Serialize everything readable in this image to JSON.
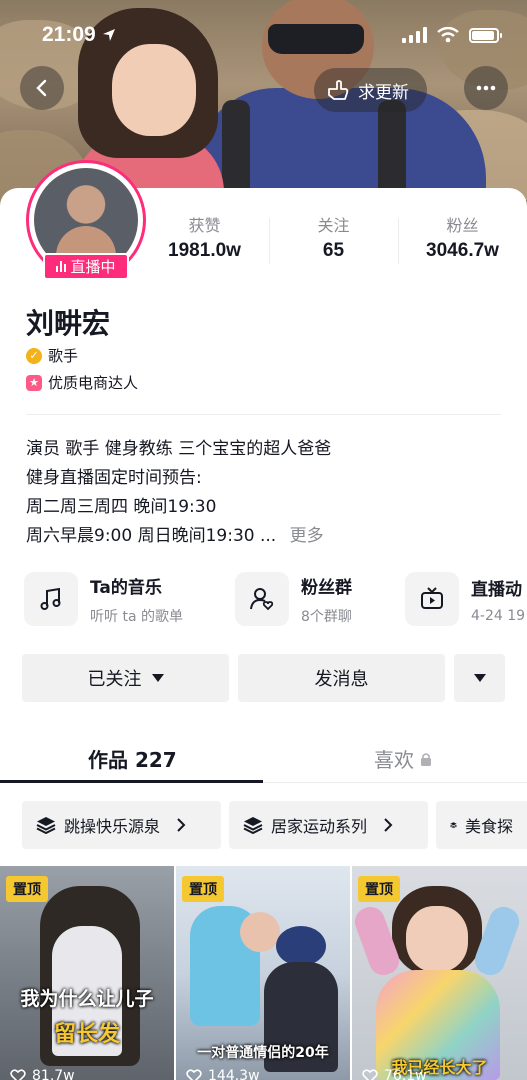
{
  "status_bar": {
    "time": "21:09"
  },
  "header": {
    "update_button_label": "求更新"
  },
  "profile": {
    "live_label": "直播中",
    "stats": [
      {
        "label": "获赞",
        "value": "1981.0w"
      },
      {
        "label": "关注",
        "value": "65"
      },
      {
        "label": "粉丝",
        "value": "3046.7w"
      }
    ],
    "name": "刘畊宏",
    "tags": [
      "歌手",
      "优质电商达人"
    ],
    "bio": [
      "演员 歌手 健身教练 三个宝宝的超人爸爸",
      "健身直播固定时间预告:",
      "周二周三周四 晚间19:30",
      "周六早晨9:00 周日晚间19:30 ..."
    ],
    "bio_more": "更多"
  },
  "features": [
    {
      "title": "Ta的音乐",
      "subtitle": "听听 ta 的歌单",
      "icon": "music-note-icon"
    },
    {
      "title": "粉丝群",
      "subtitle": "8个群聊",
      "icon": "fan-group-icon"
    },
    {
      "title": "直播动",
      "subtitle": "4-24 19",
      "icon": "tv-icon"
    }
  ],
  "actions": {
    "follow_label": "已关注",
    "message_label": "发消息"
  },
  "tabs": {
    "works_label": "作品 227",
    "likes_label": "喜欢"
  },
  "collections": [
    "跳操快乐源泉",
    "居家运动系列",
    "美食探"
  ],
  "videos": [
    {
      "pin": "置顶",
      "caption_line1": "我为什么让儿子",
      "caption_line2": "留长发",
      "likes": "81.7w"
    },
    {
      "pin": "置顶",
      "caption_line1": "一对普通情侣的20年",
      "likes": "144.3w"
    },
    {
      "pin": "置顶",
      "caption_line1": "我已经长大了",
      "likes": "76.1w"
    }
  ],
  "colors": {
    "accent_pink": "#fe2c7a",
    "pin_yellow": "#f5c731",
    "muted_text": "#8a8b91"
  }
}
